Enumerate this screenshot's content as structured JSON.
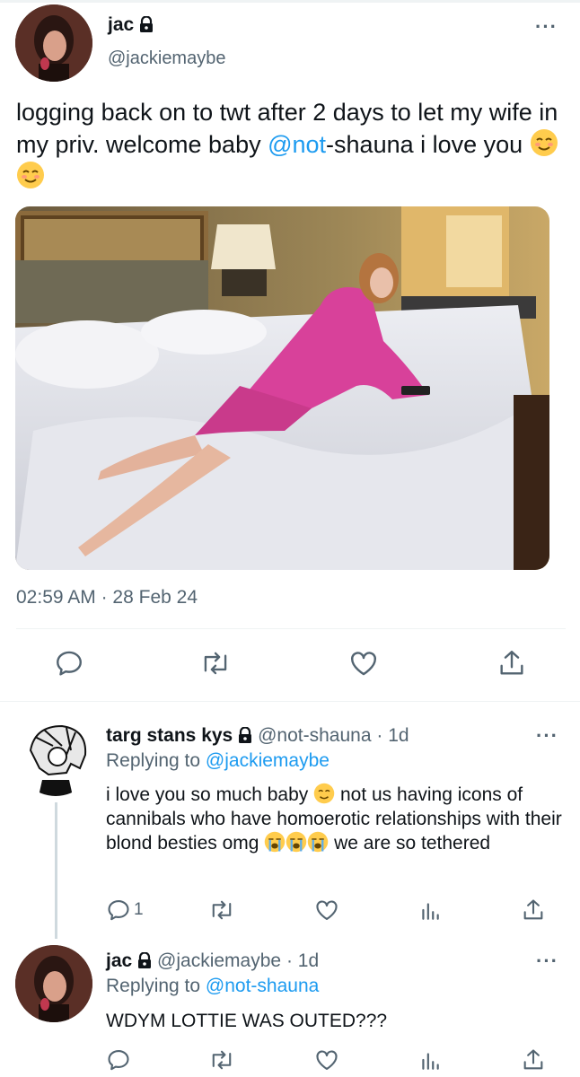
{
  "main_tweet": {
    "author_name": "jac",
    "author_handle": "@jackiemaybe",
    "text_before": "logging back on to twt after 2 days to let my wife in my priv. welcome baby ",
    "mention": "@not",
    "text_after": "-shauna i love you",
    "emoji": [
      "smiling-face-emoji",
      "smiling-face-emoji"
    ],
    "time": "02:59 AM",
    "separator": "·",
    "date": "28 Feb 24",
    "actions": [
      "reply-icon",
      "retweet-icon",
      "like-icon",
      "share-icon"
    ]
  },
  "reply1": {
    "author_name": "targ stans kys",
    "author_handle": "@not-shauna",
    "time_sep": "·",
    "time_ago": "1d",
    "replying_label": "Replying to",
    "replying_handle": "@jackiemaybe",
    "text_1": "i love you so much baby",
    "text_2": " not us having icons of cannibals who have homoerotic relationships with their blond besties omg",
    "text_3": " we are so tethered",
    "reply_count": "1"
  },
  "reply2": {
    "author_name": "jac",
    "author_handle": "@jackiemaybe",
    "time_sep": "·",
    "time_ago": "1d",
    "replying_label": "Replying to",
    "replying_handle": "@not-shauna",
    "text": "WDYM LOTTIE WAS OUTED???"
  },
  "more_label": "···",
  "colors": {
    "link": "#1d9bf0",
    "muted": "#536471",
    "text": "#0f1419",
    "divider": "#eff3f4"
  }
}
